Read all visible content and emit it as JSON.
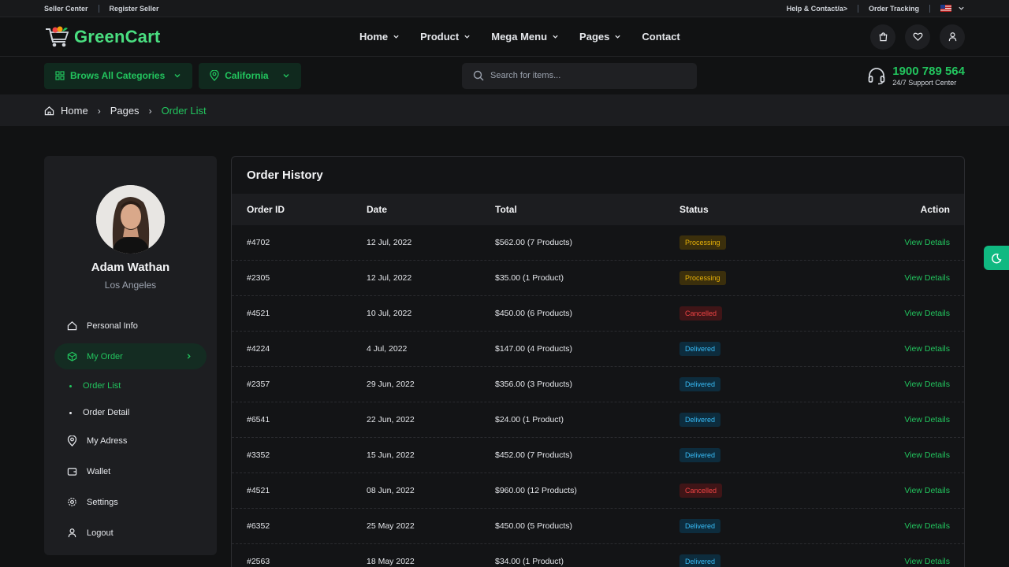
{
  "topbar": {
    "seller_center": "Seller Center",
    "register_seller": "Register Seller",
    "help_contact": "Help & Contact/a>",
    "order_tracking": "Order Tracking"
  },
  "header": {
    "logo_part1": "Green",
    "logo_part2": "Cart",
    "nav": [
      {
        "label": "Home"
      },
      {
        "label": "Product"
      },
      {
        "label": "Mega Menu"
      },
      {
        "label": "Pages"
      },
      {
        "label": "Contact"
      }
    ]
  },
  "subheader": {
    "categories_label": "Brows All Categories",
    "location_label": "California",
    "search_placeholder": "Search for items...",
    "support_phone": "1900 789 564",
    "support_label": "24/7 Support Center"
  },
  "breadcrumb": {
    "home": "Home",
    "pages": "Pages",
    "current": "Order List"
  },
  "sidebar": {
    "user_name": "Adam Wathan",
    "user_location": "Los Angeles",
    "menu": {
      "personal_info": "Personal Info",
      "my_order": "My Order",
      "order_list": "Order List",
      "order_detail": "Order Detail",
      "my_address": "My Adress",
      "wallet": "Wallet",
      "settings": "Settings",
      "logout": "Logout"
    }
  },
  "orders": {
    "title": "Order History",
    "columns": [
      "Order ID",
      "Date",
      "Total",
      "Status",
      "Action"
    ],
    "action_label": "View Details",
    "rows": [
      {
        "id": "#4702",
        "date": "12 Jul, 2022",
        "total": "$562.00 (7 Products)",
        "status": "Processing"
      },
      {
        "id": "#2305",
        "date": "12 Jul, 2022",
        "total": "$35.00 (1 Product)",
        "status": "Processing"
      },
      {
        "id": "#4521",
        "date": "10 Jul, 2022",
        "total": "$450.00 (6 Products)",
        "status": "Cancelled"
      },
      {
        "id": "#4224",
        "date": "4 Jul, 2022",
        "total": "$147.00 (4 Products)",
        "status": "Delivered"
      },
      {
        "id": "#2357",
        "date": "29 Jun, 2022",
        "total": "$356.00 (3 Products)",
        "status": "Delivered"
      },
      {
        "id": "#6541",
        "date": "22 Jun, 2022",
        "total": "$24.00 (1 Product)",
        "status": "Delivered"
      },
      {
        "id": "#3352",
        "date": "15 Jun, 2022",
        "total": "$452.00 (7 Products)",
        "status": "Delivered"
      },
      {
        "id": "#4521",
        "date": "08 Jun, 2022",
        "total": "$960.00 (12 Products)",
        "status": "Cancelled"
      },
      {
        "id": "#6352",
        "date": "25 May 2022",
        "total": "$450.00 (5 Products)",
        "status": "Delivered"
      },
      {
        "id": "#2563",
        "date": "18 May 2022",
        "total": "$34.00 (1 Product)",
        "status": "Delivered"
      }
    ]
  },
  "colors": {
    "accent": "#22c55e",
    "processing": "#eab308",
    "cancelled": "#ef4444",
    "delivered": "#38bdf8",
    "background": "#111213"
  }
}
